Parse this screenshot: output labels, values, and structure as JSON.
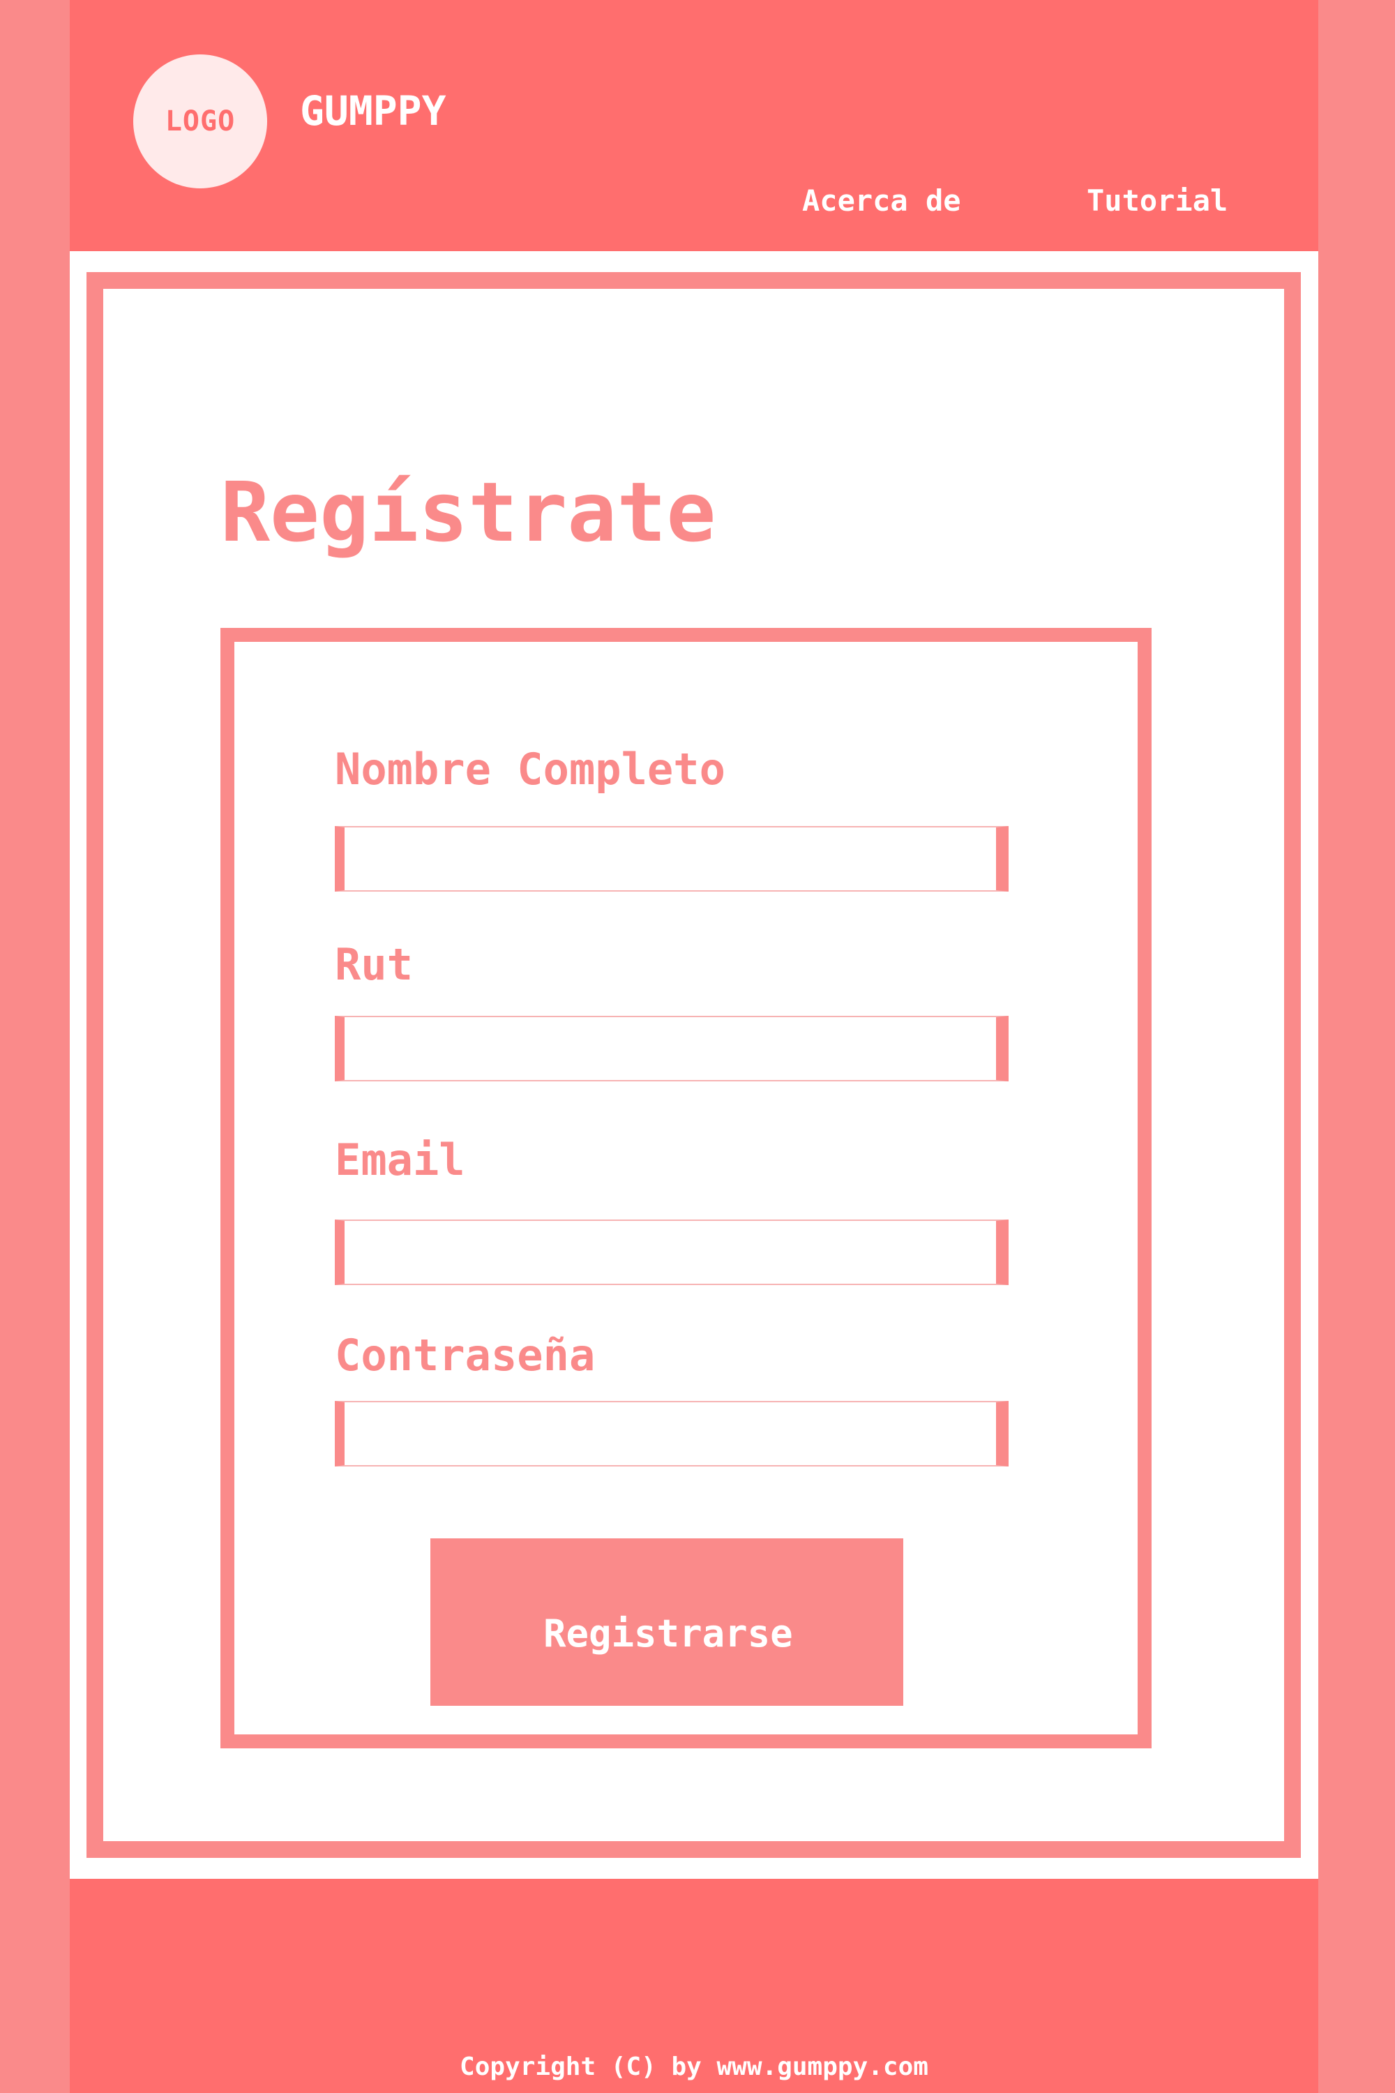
{
  "header": {
    "logo_text": "LOGO",
    "brand": "GUMPPY",
    "nav": {
      "about": "Acerca de",
      "tutorial": "Tutorial"
    }
  },
  "main": {
    "title": "Regístrate",
    "form": {
      "fields": [
        {
          "label": "Nombre Completo",
          "value": ""
        },
        {
          "label": "Rut",
          "value": ""
        },
        {
          "label": "Email",
          "value": ""
        },
        {
          "label": "Contraseña",
          "value": ""
        }
      ],
      "submit_label": "Registrarse"
    }
  },
  "footer": {
    "copyright": "Copyright (C) by www.gumppy.com"
  },
  "colors": {
    "side_background": "#fa8a8a",
    "header_footer": "#ff6e6e",
    "accent": "#fa8a8a",
    "logo_circle": "#ffeaea"
  }
}
